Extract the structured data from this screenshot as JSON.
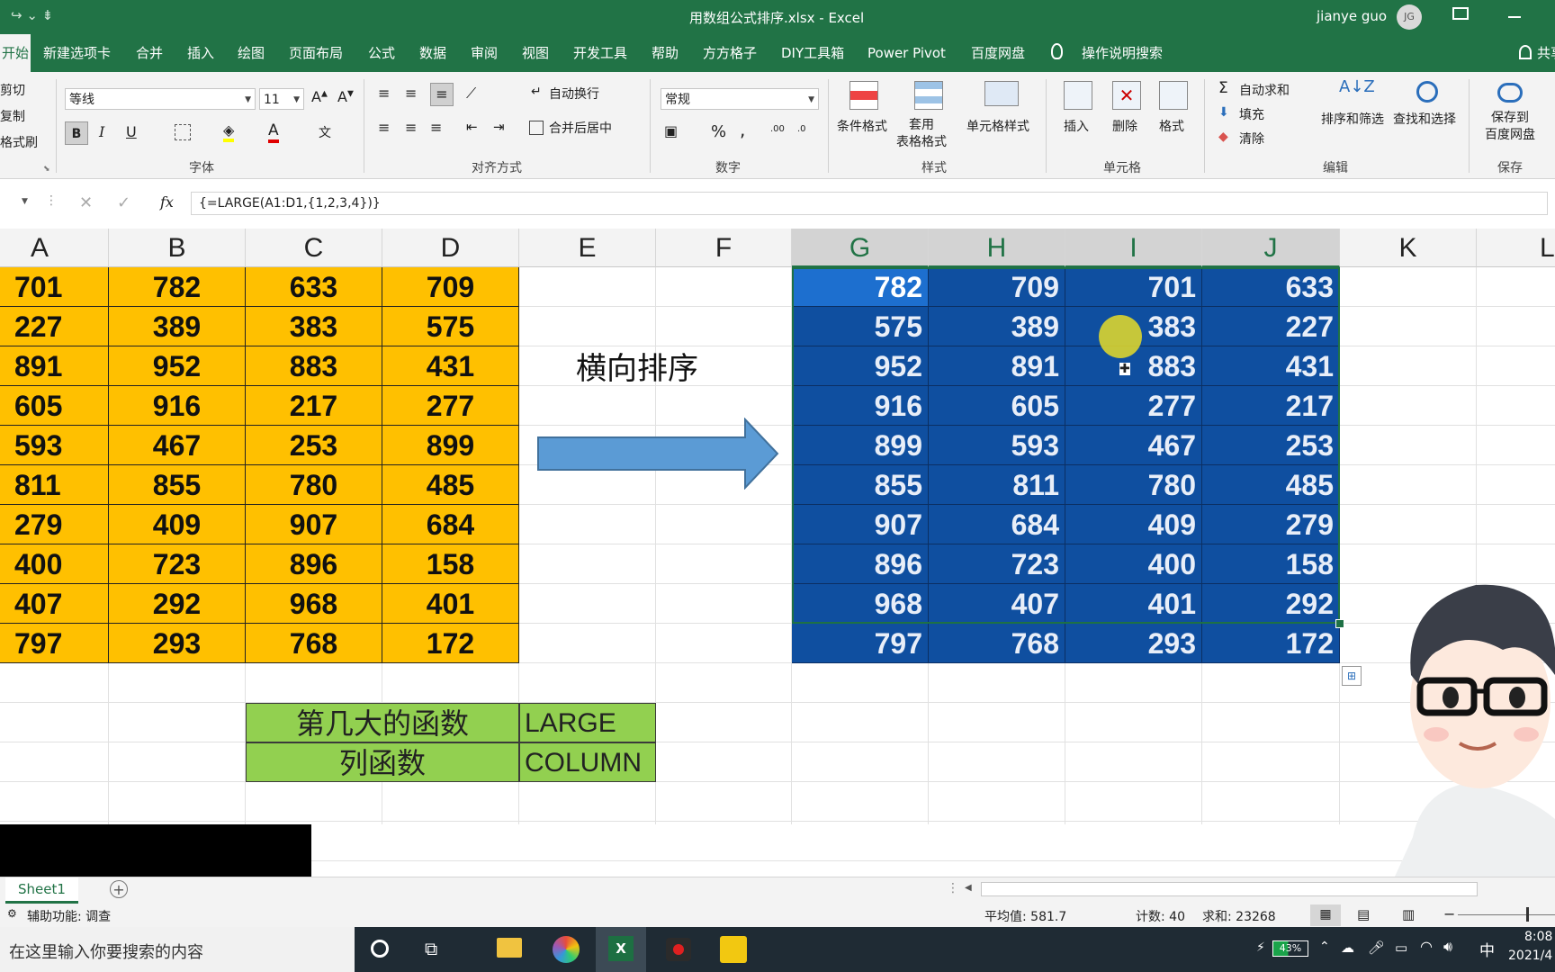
{
  "window": {
    "title": "用数组公式排序.xlsx  -  Excel",
    "user": "jianye guo",
    "user_initials": "JG",
    "qat_symbol": "↪ ⌄  ⇟"
  },
  "tabs": [
    "开始",
    "新建选项卡",
    "合并",
    "插入",
    "绘图",
    "页面布局",
    "公式",
    "数据",
    "审阅",
    "视图",
    "开发工具",
    "帮助",
    "方方格子",
    "DIY工具箱",
    "Power Pivot",
    "百度网盘"
  ],
  "tell_me": "操作说明搜索",
  "share_label": "共享",
  "clipboard": {
    "cut": "剪切",
    "copy": "复制",
    "painter": "格式刷"
  },
  "font": {
    "name": "等线",
    "size": "11",
    "group": "字体",
    "bold": "B",
    "italic": "I",
    "underline": "U"
  },
  "alignment": {
    "wrap": "自动换行",
    "merge": "合并后居中",
    "group": "对齐方式"
  },
  "number": {
    "format": "常规",
    "group": "数字",
    "percent": "%",
    "comma": ","
  },
  "styles": {
    "cond": "条件格式",
    "table": "套用\n表格格式",
    "cell": "单元格样式",
    "group": "样式"
  },
  "cells": {
    "insert": "插入",
    "delete": "删除",
    "format": "格式",
    "group": "单元格"
  },
  "editing": {
    "autosum": "自动求和",
    "fill": "填充",
    "clear": "清除",
    "sort": "排序和筛选",
    "find": "查找和选择",
    "group": "编辑"
  },
  "save_group": {
    "save": "保存到\n百度网盘",
    "group": "保存"
  },
  "formula": {
    "content": "{=LARGE(A1:D1,{1,2,3,4})}",
    "fx": "fx"
  },
  "columns": [
    "A",
    "B",
    "C",
    "D",
    "E",
    "F",
    "G",
    "H",
    "I",
    "J",
    "K",
    "L"
  ],
  "source_table": [
    [
      "701",
      "782",
      "633",
      "709"
    ],
    [
      "227",
      "389",
      "383",
      "575"
    ],
    [
      "891",
      "952",
      "883",
      "431"
    ],
    [
      "605",
      "916",
      "217",
      "277"
    ],
    [
      "593",
      "467",
      "253",
      "899"
    ],
    [
      "811",
      "855",
      "780",
      "485"
    ],
    [
      "279",
      "409",
      "907",
      "684"
    ],
    [
      "400",
      "723",
      "896",
      "158"
    ],
    [
      "407",
      "292",
      "968",
      "401"
    ],
    [
      "797",
      "293",
      "768",
      "172"
    ]
  ],
  "sorted_table": [
    [
      "782",
      "709",
      "701",
      "633"
    ],
    [
      "575",
      "389",
      "383",
      "227"
    ],
    [
      "952",
      "891",
      "883",
      "431"
    ],
    [
      "916",
      "605",
      "277",
      "217"
    ],
    [
      "899",
      "593",
      "467",
      "253"
    ],
    [
      "855",
      "811",
      "780",
      "485"
    ],
    [
      "907",
      "684",
      "409",
      "279"
    ],
    [
      "896",
      "723",
      "400",
      "158"
    ],
    [
      "968",
      "407",
      "401",
      "292"
    ],
    [
      "797",
      "768",
      "293",
      "172"
    ]
  ],
  "arrow_label": "横向排序",
  "legend_table": [
    [
      "第几大的函数",
      "LARGE"
    ],
    [
      "列函数",
      "COLUMN"
    ]
  ],
  "sheet_tab": "Sheet1",
  "status": {
    "accessibility": "辅助功能: 调查",
    "average": "平均值: 581.7",
    "count": "计数: 40",
    "sum": "求和: 23268"
  },
  "taskbar": {
    "search": "在这里输入你要搜索的内容",
    "battery": "43%",
    "ime": "中",
    "time": "8:08",
    "date": "2021/4"
  },
  "colors": {
    "excel_green": "#217346",
    "selection_blue": "#0f4fa0",
    "source_yellow": "#ffc000",
    "legend_green": "#92d050",
    "arrow_blue": "#5b9bd5"
  }
}
